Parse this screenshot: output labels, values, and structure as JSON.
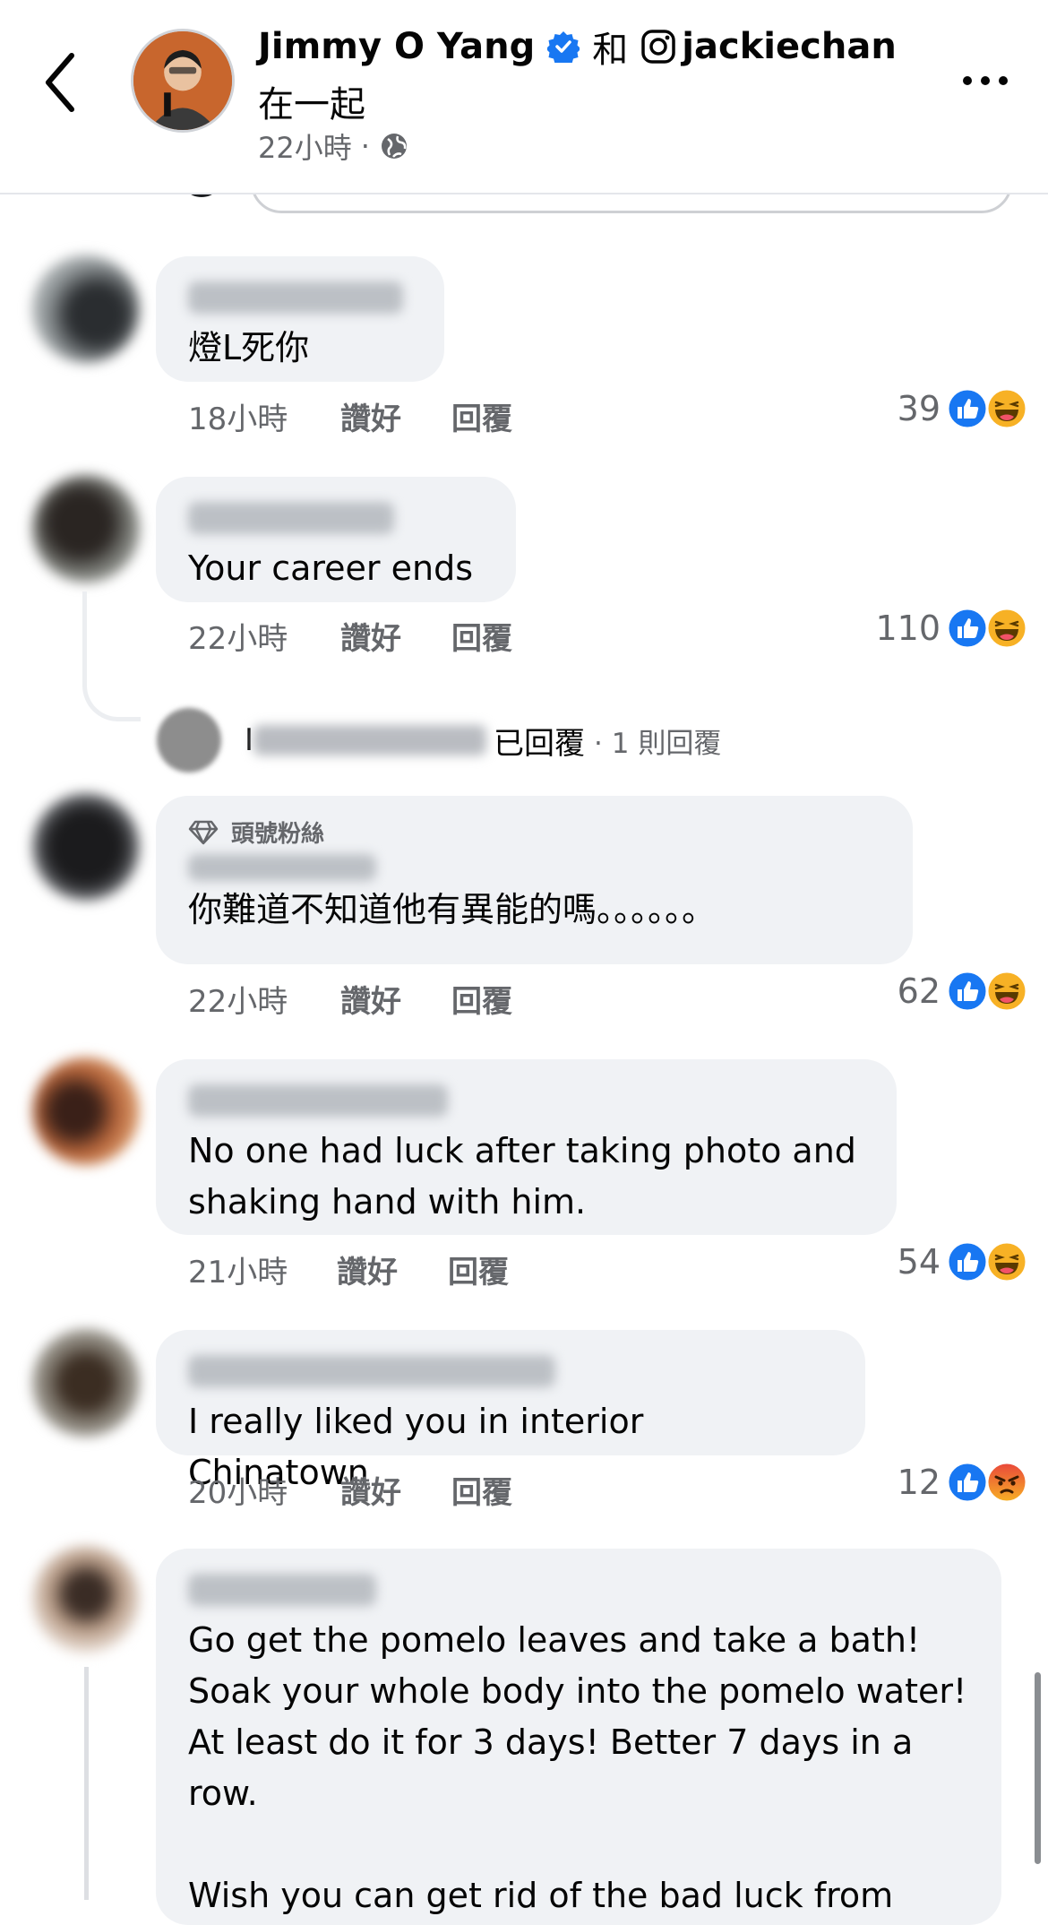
{
  "header": {
    "author": "Jimmy O Yang",
    "with_word": "和",
    "instagram_handle": "jackiechan",
    "subtitle": "在一起",
    "time_ago": "22小時",
    "separator": "·",
    "privacy_icon": "globe-icon",
    "verified_color": "#1877f2"
  },
  "comments": [
    {
      "text": "燈L死你",
      "time": "18小時",
      "like_label": "讚好",
      "reply_label": "回覆",
      "reaction_count": "39",
      "reactions": [
        "like",
        "haha"
      ]
    },
    {
      "text": "Your career ends",
      "time": "22小時",
      "like_label": "讚好",
      "reply_label": "回覆",
      "reaction_count": "110",
      "reactions": [
        "like",
        "haha"
      ]
    },
    {
      "badge": "頭號粉絲",
      "text": "你難道不知道他有異能的嗎。。。。。。",
      "time": "22小時",
      "like_label": "讚好",
      "reply_label": "回覆",
      "reaction_count": "62",
      "reactions": [
        "like",
        "haha"
      ]
    },
    {
      "text": "No one had luck after taking photo and\nshaking hand with him.",
      "time": "21小時",
      "like_label": "讚好",
      "reply_label": "回覆",
      "reaction_count": "54",
      "reactions": [
        "like",
        "haha"
      ]
    },
    {
      "text": "I really liked you in interior Chinatown",
      "time": "20小時",
      "like_label": "讚好",
      "reply_label": "回覆",
      "reaction_count": "12",
      "reactions": [
        "like",
        "angry"
      ]
    },
    {
      "text": "Go get the pomelo leaves and take a bath!\nSoak your whole body into the pomelo water!\nAt least do it for 3 days! Better 7 days in a\nrow.\n\nWish you can get rid of the bad luck from"
    }
  ],
  "reply_summary": {
    "initial": "I",
    "action": "已回覆",
    "count": "· 1 則回覆"
  },
  "colors": {
    "bubble_bg": "#f0f2f5",
    "meta_text": "#65676b",
    "like_blue": "#1877f2",
    "haha_yellow": "#f7b125",
    "angry_red": "#e9710f"
  }
}
